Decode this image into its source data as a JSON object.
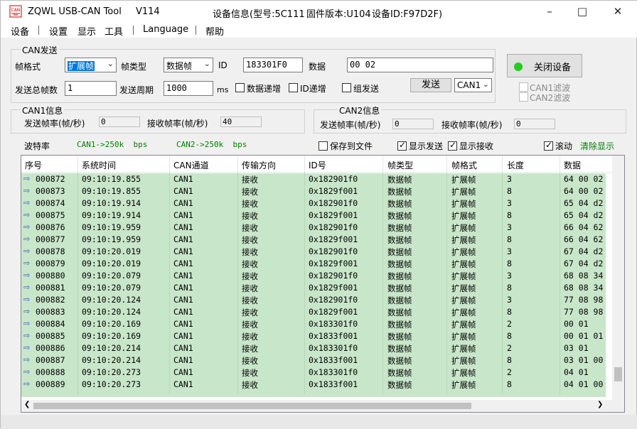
{
  "title": {
    "app_name": "ZQWL USB-CAN Tool",
    "version": "V114",
    "device_info": "设备信息(型号:5C111",
    "firmware": "固件版本:U104",
    "device_id": "设备ID:F97D2F)"
  },
  "menu": [
    "设备",
    "设置",
    "显示",
    "工具",
    "Language",
    "帮助"
  ],
  "can_send": {
    "group_label": "CAN发送",
    "frame_format_label": "帧格式",
    "frame_format_value": "扩展帧",
    "frame_type_label": "帧类型",
    "frame_type_value": "数据帧",
    "id_label": "ID",
    "id_value": "183301F0",
    "data_label": "数据",
    "data_value": "00 02",
    "total_frames_label": "发送总帧数",
    "total_frames_value": "1",
    "period_label": "发送周期",
    "period_value": "1000",
    "period_unit": "ms",
    "data_increment": "数据递增",
    "id_increment": "ID递增",
    "group_send": "组发送",
    "send_button": "发送",
    "channel_value": "CAN1"
  },
  "device_button": "关闭设备",
  "filters": [
    "CAN1滤波",
    "CAN2滤波"
  ],
  "can1_info": {
    "label": "CAN1信息",
    "send_rate_label": "发送帧率(帧/秒)",
    "send_rate_value": "0",
    "recv_rate_label": "接收帧率(帧/秒)",
    "recv_rate_value": "40"
  },
  "can2_info": {
    "label": "CAN2信息",
    "send_rate_label": "发送帧率(帧/秒)",
    "send_rate_value": "0",
    "recv_rate_label": "接收帧率(帧/秒)",
    "recv_rate_value": "0"
  },
  "baud": {
    "label": "波特率",
    "can1": "CAN1->250k  bps",
    "can2": "CAN2->250k  bps"
  },
  "options": {
    "save_to_file": "保存到文件",
    "show_send": "显示发送",
    "show_recv": "显示接收",
    "scroll": "滚动",
    "clear": "清除显示"
  },
  "table": {
    "columns": [
      "序号",
      "系统时间",
      "CAN通道",
      "传输方向",
      "ID号",
      "帧类型",
      "帧格式",
      "长度",
      "数据"
    ],
    "rows": [
      [
        "000872",
        "09:10:19.855",
        "CAN1",
        "接收",
        "0x182901f0",
        "数据帧",
        "扩展帧",
        "3",
        "64 00 02"
      ],
      [
        "000873",
        "09:10:19.855",
        "CAN1",
        "接收",
        "0x1829f001",
        "数据帧",
        "扩展帧",
        "8",
        "64 00 02"
      ],
      [
        "000874",
        "09:10:19.914",
        "CAN1",
        "接收",
        "0x182901f0",
        "数据帧",
        "扩展帧",
        "3",
        "65 04 d2"
      ],
      [
        "000875",
        "09:10:19.914",
        "CAN1",
        "接收",
        "0x1829f001",
        "数据帧",
        "扩展帧",
        "8",
        "65 04 d2"
      ],
      [
        "000876",
        "09:10:19.959",
        "CAN1",
        "接收",
        "0x182901f0",
        "数据帧",
        "扩展帧",
        "3",
        "66 04 62"
      ],
      [
        "000877",
        "09:10:19.959",
        "CAN1",
        "接收",
        "0x1829f001",
        "数据帧",
        "扩展帧",
        "8",
        "66 04 62"
      ],
      [
        "000878",
        "09:10:20.019",
        "CAN1",
        "接收",
        "0x182901f0",
        "数据帧",
        "扩展帧",
        "3",
        "67 04 d2"
      ],
      [
        "000879",
        "09:10:20.019",
        "CAN1",
        "接收",
        "0x1829f001",
        "数据帧",
        "扩展帧",
        "8",
        "67 04 d2"
      ],
      [
        "000880",
        "09:10:20.079",
        "CAN1",
        "接收",
        "0x182901f0",
        "数据帧",
        "扩展帧",
        "3",
        "68 08 34"
      ],
      [
        "000881",
        "09:10:20.079",
        "CAN1",
        "接收",
        "0x1829f001",
        "数据帧",
        "扩展帧",
        "8",
        "68 08 34"
      ],
      [
        "000882",
        "09:10:20.124",
        "CAN1",
        "接收",
        "0x182901f0",
        "数据帧",
        "扩展帧",
        "3",
        "77 08 98"
      ],
      [
        "000883",
        "09:10:20.124",
        "CAN1",
        "接收",
        "0x1829f001",
        "数据帧",
        "扩展帧",
        "8",
        "77 08 98"
      ],
      [
        "000884",
        "09:10:20.169",
        "CAN1",
        "接收",
        "0x183301f0",
        "数据帧",
        "扩展帧",
        "2",
        "00 01"
      ],
      [
        "000885",
        "09:10:20.169",
        "CAN1",
        "接收",
        "0x1833f001",
        "数据帧",
        "扩展帧",
        "8",
        "00 01 01"
      ],
      [
        "000886",
        "09:10:20.214",
        "CAN1",
        "接收",
        "0x183301f0",
        "数据帧",
        "扩展帧",
        "2",
        "03 01"
      ],
      [
        "000887",
        "09:10:20.214",
        "CAN1",
        "接收",
        "0x1833f001",
        "数据帧",
        "扩展帧",
        "8",
        "03 01 00"
      ],
      [
        "000888",
        "09:10:20.273",
        "CAN1",
        "接收",
        "0x183301f0",
        "数据帧",
        "扩展帧",
        "2",
        "04 01"
      ],
      [
        "000889",
        "09:10:20.273",
        "CAN1",
        "接收",
        "0x1833f001",
        "数据帧",
        "扩展帧",
        "8",
        "04 01 00"
      ]
    ]
  },
  "colors": {
    "row_bg": "#c8e6c9",
    "accent": "#0078d7",
    "status_led": "#22cc22",
    "baud_text": "#008000"
  }
}
